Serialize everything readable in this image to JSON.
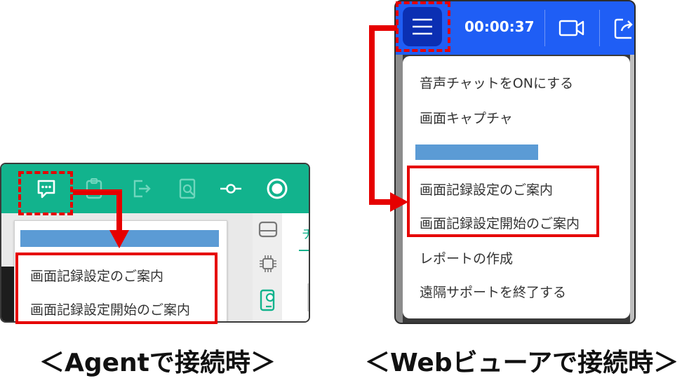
{
  "agent": {
    "menu_items": [
      "画面記録設定のご案内",
      "画面記録設定開始のご案内"
    ],
    "side_label": "チ",
    "caption": "＜Agentで接続時＞"
  },
  "web": {
    "timer": "00:00:37",
    "menu_items": [
      "音声チャットをONにする",
      "画面キャプチャ",
      "画面記録設定のご案内",
      "画面記録設定開始のご案内",
      "レポートの作成",
      "遠隔サポートを終了する"
    ],
    "caption": "＜Webビューアで接続時＞"
  },
  "colors": {
    "agent_bar": "#12b38d",
    "web_bar": "#1f5ef5",
    "highlight_red": "#e60000",
    "redacted_blue": "#5b9bd5"
  },
  "icons": [
    "chat-icon",
    "clipboard-icon",
    "exit-icon",
    "search-doc-icon",
    "slider-icon",
    "record-icon",
    "drive-icon",
    "chip-icon",
    "phone-user-icon",
    "menu-icon",
    "video-camera-icon",
    "share-icon"
  ]
}
